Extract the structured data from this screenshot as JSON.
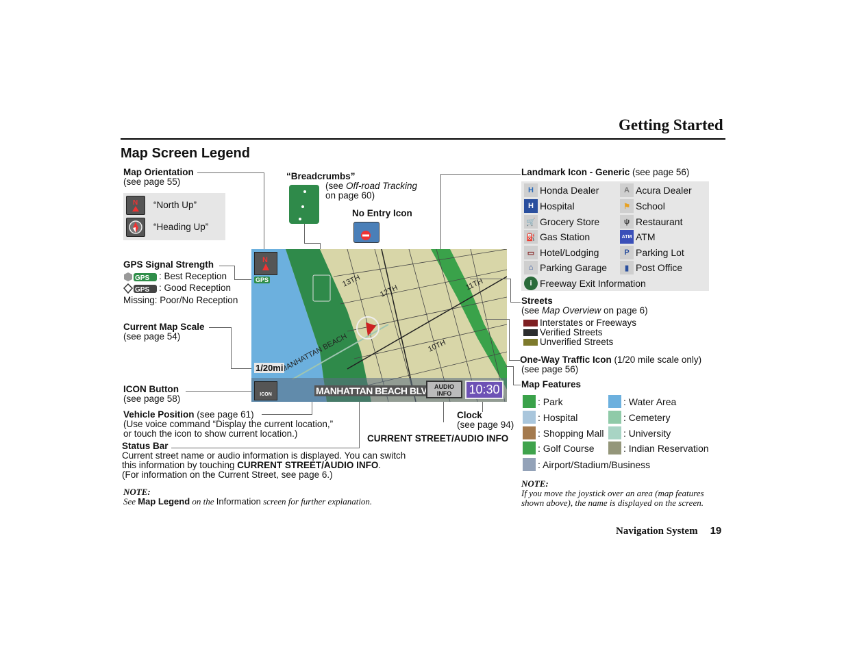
{
  "header": {
    "section_title": "Getting Started",
    "page_title": "Map Screen Legend"
  },
  "map_orientation": {
    "title": "Map Orientation",
    "ref": "(see page 55)",
    "items": [
      {
        "icon": "north-up-icon",
        "label": "“North Up”"
      },
      {
        "icon": "heading-up-icon",
        "label": "“Heading Up”"
      }
    ]
  },
  "gps": {
    "title": "GPS Signal Strength",
    "best": ": Best Reception",
    "good": ": Good Reception",
    "missing": "Missing: Poor/No Reception",
    "badge": "GPS"
  },
  "map_scale": {
    "title": "Current Map Scale",
    "ref": "(see page 54)"
  },
  "icon_button": {
    "title": "ICON Button",
    "ref": "(see page 58)"
  },
  "vehicle_position": {
    "title": "Vehicle Position",
    "ref": " (see page 61)",
    "line1": "(Use voice command “Display the current location,”",
    "line2": "or touch the icon to show current location.)"
  },
  "status_bar": {
    "title": "Status Bar",
    "line1": "Current street name or audio information is displayed. You can switch",
    "line2_pre": "this information by touching ",
    "line2_bold": "CURRENT STREET/AUDIO INFO",
    "line2_post": ".",
    "line3": "(For information on the Current Street, see page 6.)"
  },
  "note_left": {
    "title": "NOTE:",
    "see": "See ",
    "bold": "Map Legend",
    "mid": " on the ",
    "info": "Information",
    "end": " screen for further explanation."
  },
  "breadcrumbs": {
    "title": "“Breadcrumbs”",
    "ref_pre": "(see ",
    "ref_i": "Off-road Tracking",
    "ref_post": "on page 60)"
  },
  "no_entry": {
    "title": "No Entry Icon"
  },
  "clock_label": {
    "title": "Clock",
    "ref": "(see page 94)"
  },
  "current_street_label": "CURRENT STREET/AUDIO INFO",
  "map": {
    "scale": "1/20mi",
    "gps_badge": "GPS",
    "icon_btn": "ICON",
    "street": "MANHATTAN BEACH BLVD",
    "audio_info_1": "AUDIO",
    "audio_info_2": "INFO",
    "clock": "10:30",
    "streets": [
      "13TH",
      "12TH",
      "11TH",
      "10TH",
      "MANHATTAN BEACH"
    ]
  },
  "landmarks": {
    "title": "Landmark Icon - Generic",
    "ref": " (see page 56)",
    "items": [
      {
        "icon": "honda-dealer-icon",
        "label": "Honda Dealer"
      },
      {
        "icon": "acura-dealer-icon",
        "label": "Acura Dealer"
      },
      {
        "icon": "hospital-icon",
        "label": "Hospital"
      },
      {
        "icon": "school-icon",
        "label": "School"
      },
      {
        "icon": "grocery-store-icon",
        "label": "Grocery Store"
      },
      {
        "icon": "restaurant-icon",
        "label": "Restaurant"
      },
      {
        "icon": "gas-station-icon",
        "label": "Gas Station"
      },
      {
        "icon": "atm-icon",
        "label": "ATM"
      },
      {
        "icon": "hotel-icon",
        "label": "Hotel/Lodging"
      },
      {
        "icon": "parking-lot-icon",
        "label": "Parking Lot"
      },
      {
        "icon": "parking-garage-icon",
        "label": "Parking Garage"
      },
      {
        "icon": "post-office-icon",
        "label": "Post Office"
      },
      {
        "icon": "freeway-exit-icon",
        "label": "Freeway Exit Information"
      }
    ]
  },
  "streets": {
    "title": "Streets",
    "ref_pre": "(see ",
    "ref_i": "Map Overview",
    "ref_post": " on page 6)",
    "items": [
      {
        "label": "Interstates or Freeways",
        "color": "#7e1f22"
      },
      {
        "label": "Verified Streets",
        "color": "#2b2d2e"
      },
      {
        "label": "Unverified Streets",
        "color": "#7d7a2c"
      }
    ]
  },
  "one_way": {
    "title": "One-Way Traffic Icon",
    "note": " (1/20 mile scale only)",
    "ref": "(see page 56)"
  },
  "map_features": {
    "title": "Map Features",
    "items": [
      {
        "label": ": Park",
        "color": "#3aa24a"
      },
      {
        "label": ": Water Area",
        "color": "#6cb0de"
      },
      {
        "label": ": Hospital",
        "color": "#a9c6dc"
      },
      {
        "label": ": Cemetery",
        "color": "#8fcaa8"
      },
      {
        "label": ": Shopping Mall",
        "color": "#a47a4e"
      },
      {
        "label": ": University",
        "color": "#a8d4c4"
      },
      {
        "label": ": Golf Course",
        "color": "#3fa34c"
      },
      {
        "label": ": Indian Reservation",
        "color": "#94967a"
      },
      {
        "label": ": Airport/Stadium/Business",
        "color": "#93a2b8"
      }
    ]
  },
  "note_right": {
    "title": "NOTE:",
    "line1": "If you move the joystick over an area (map features",
    "line2": "shown above), the name is displayed on the screen."
  },
  "footer": {
    "label": "Navigation System",
    "page": "19"
  }
}
